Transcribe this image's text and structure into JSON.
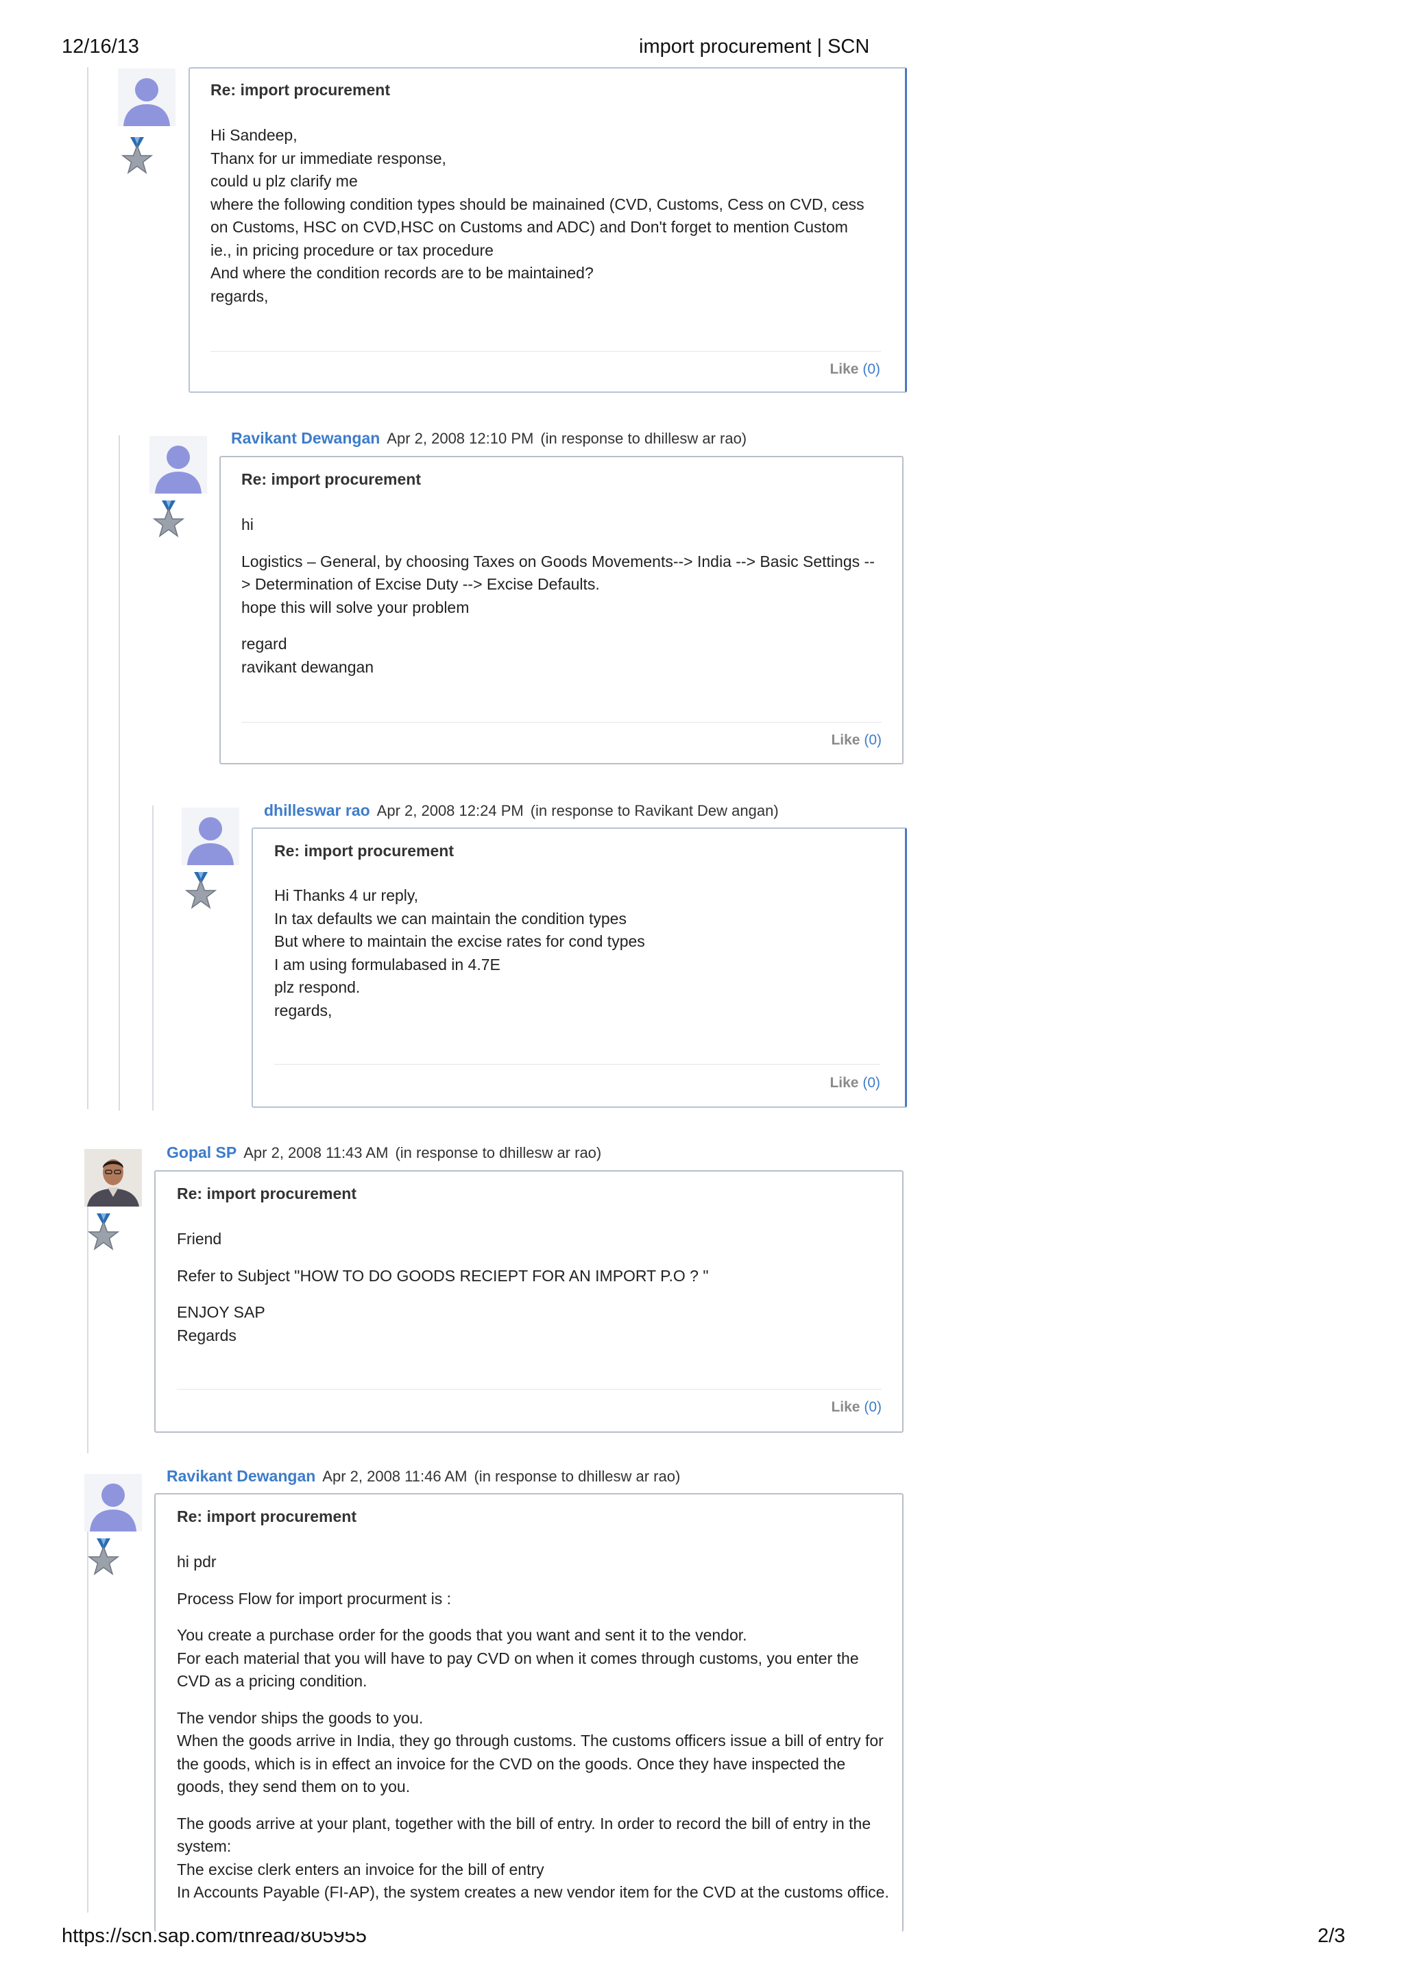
{
  "header": {
    "date": "12/16/13",
    "title": "import procurement | SCN"
  },
  "footer": {
    "url": "https://scn.sap.com/thread/805955",
    "page": "2/3"
  },
  "posts": [
    {
      "author": "",
      "date": "",
      "in_response": "",
      "subject": "Re: import procurement",
      "paragraphs": [
        [
          "Hi Sandeep,",
          "Thanx for ur immediate response,",
          "could u plz clarify me",
          "where the following condition types should be mainained (CVD, Customs, Cess on CVD, cess",
          "on Customs, HSC on CVD,HSC on Customs and ADC) and Don't forget to mention Custom",
          "ie., in pricing procedure or tax procedure",
          "And where the condition records are to be maintained?",
          "regards,"
        ]
      ],
      "like_label": "Like",
      "like_count": "(0)"
    },
    {
      "author": "Ravikant Dewangan",
      "date": "Apr 2, 2008 12:10 PM",
      "in_response": "(in response to dhillesw ar rao)",
      "subject": "Re: import procurement",
      "paragraphs": [
        [
          "hi"
        ],
        [
          "Logistics – General, by choosing Taxes on Goods Movements--> India -->  Basic Settings --",
          "> Determination of Excise Duty --> Excise Defaults.",
          "hope this will solve your problem"
        ],
        [
          "regard",
          "ravikant dewangan"
        ]
      ],
      "like_label": "Like",
      "like_count": "(0)"
    },
    {
      "author": "dhilleswar rao",
      "date": "Apr 2, 2008 12:24 PM",
      "in_response": "(in response to Ravikant Dew angan)",
      "subject": "Re: import procurement",
      "paragraphs": [
        [
          "Hi Thanks 4 ur reply,",
          "In tax defaults we can maintain the condition types",
          "But where to maintain the excise rates for cond types",
          "I am using formulabased in 4.7E",
          "plz respond.",
          "regards,"
        ]
      ],
      "like_label": "Like",
      "like_count": "(0)"
    },
    {
      "author": "Gopal SP",
      "date": "Apr 2, 2008 11:43 AM",
      "in_response": "(in response to dhillesw ar rao)",
      "subject": "Re: import procurement",
      "paragraphs": [
        [
          "Friend"
        ],
        [
          "Refer to Subject \"HOW TO DO GOODS RECIEPT FOR AN IMPORT P.O ? \""
        ],
        [
          "ENJOY SAP",
          "Regards"
        ]
      ],
      "like_label": "Like",
      "like_count": "(0)"
    },
    {
      "author": "Ravikant Dewangan",
      "date": "Apr 2, 2008 11:46 AM",
      "in_response": "(in response to dhillesw ar rao)",
      "subject": "Re: import procurement",
      "paragraphs": [
        [
          "hi pdr"
        ],
        [
          "Process Flow  for import procurment is :"
        ],
        [
          "You create a purchase order for the goods that you want and sent it to the vendor.",
          "For each material that you will have to pay CVD on when it comes through customs, you enter the",
          "CVD as a pricing condition."
        ],
        [
          "The vendor ships the goods to you.",
          "When the goods arrive in India, they go through customs. The customs officers issue a bill of entry for",
          "the goods, which is in effect an invoice for the CVD on the goods. Once they have inspected the",
          "goods, they send them on to you."
        ],
        [
          "The goods arrive at your plant, together with the bill of entry. In order to record the bill of entry in the",
          "system:",
          "The excise clerk enters an invoice for the bill of entry",
          "In Accounts Payable (FI-AP), the system creates a new vendor item for the CVD at the customs office."
        ]
      ],
      "like_label": "",
      "like_count": ""
    }
  ]
}
